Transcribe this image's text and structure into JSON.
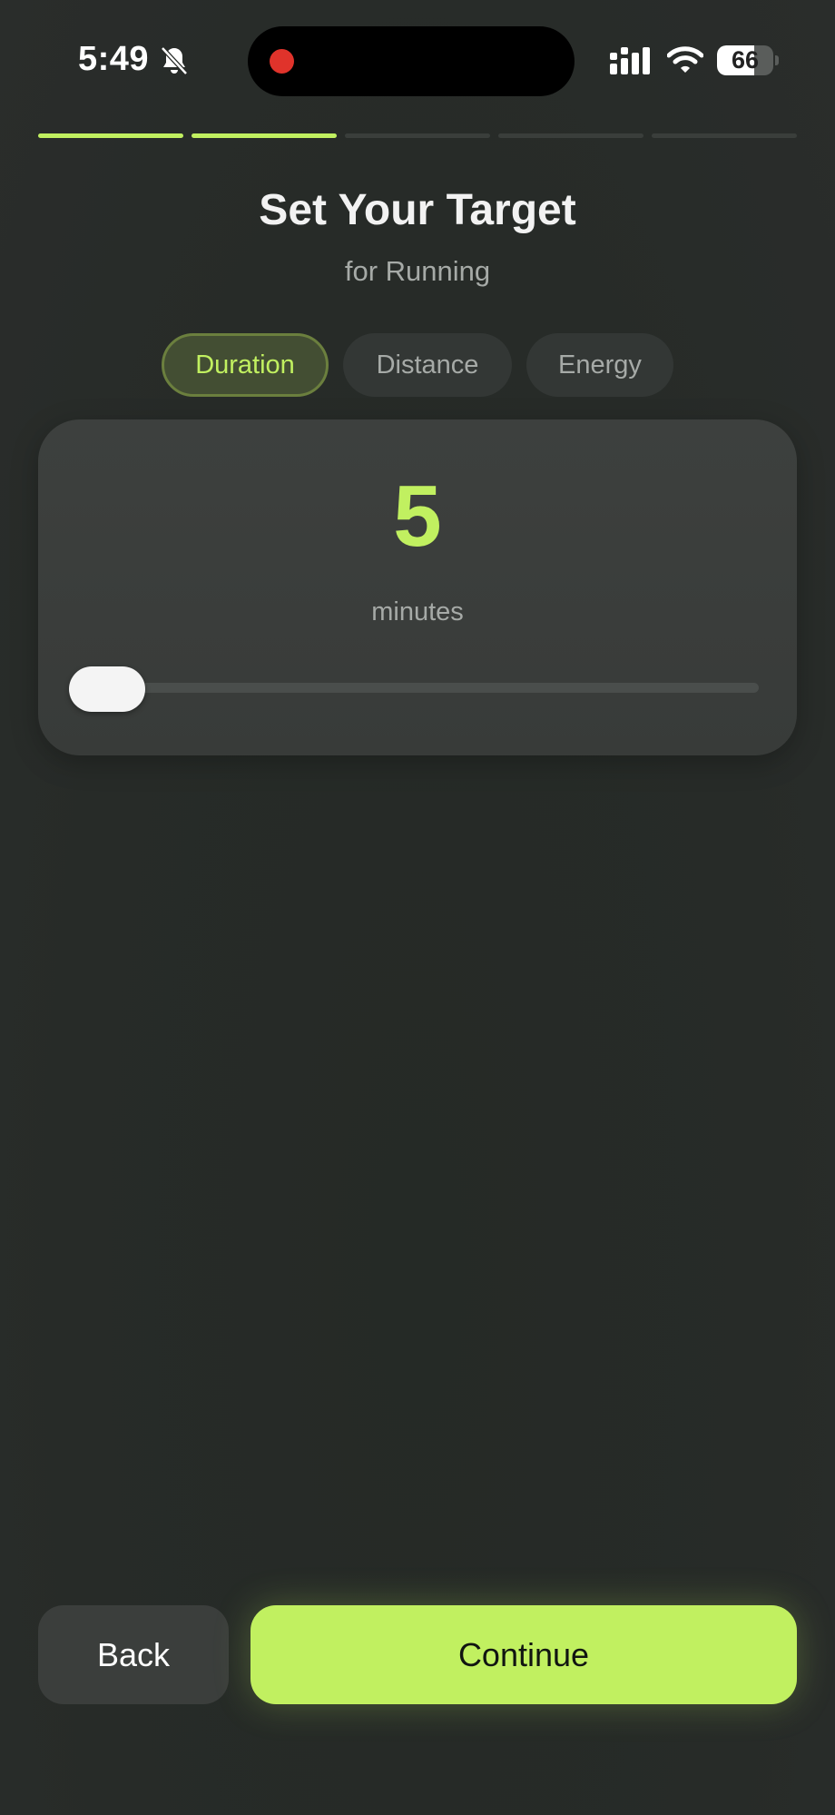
{
  "status_bar": {
    "time": "5:49",
    "battery_level": "66",
    "battery_fraction": 0.66
  },
  "progress": {
    "total_steps": 5,
    "completed_steps": 2
  },
  "header": {
    "title": "Set Your Target",
    "subtitle": "for Running"
  },
  "tabs": [
    {
      "label": "Duration",
      "active": true
    },
    {
      "label": "Distance",
      "active": false
    },
    {
      "label": "Energy",
      "active": false
    }
  ],
  "target_card": {
    "value": "5",
    "unit": "minutes",
    "slider_fraction": 0.0
  },
  "footer": {
    "back_label": "Back",
    "continue_label": "Continue"
  },
  "colors": {
    "accent": "#c1f060",
    "background": "#272b28",
    "card": "#3b3e3c",
    "muted_text": "#a6aaa7"
  },
  "icons": [
    "bell-slash-icon",
    "signal-icon",
    "wifi-icon",
    "battery-icon"
  ]
}
